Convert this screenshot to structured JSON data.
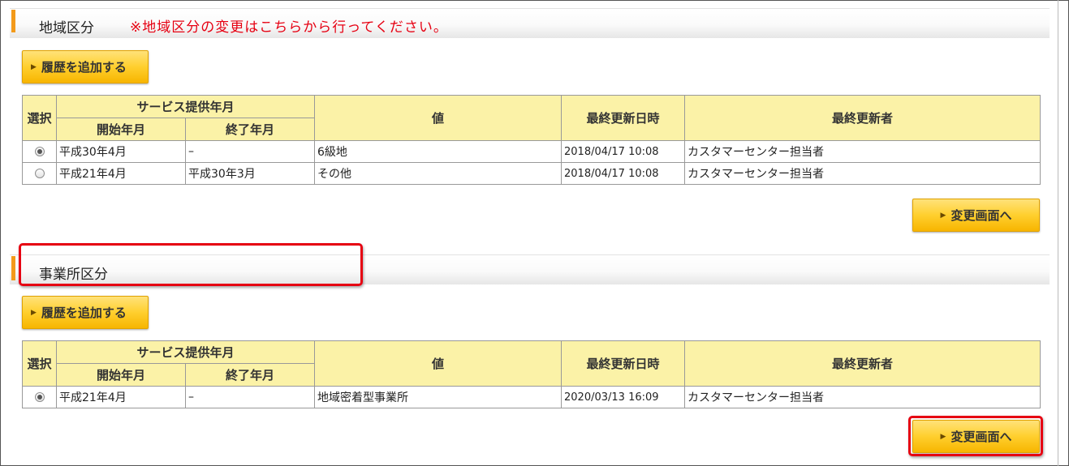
{
  "sections": [
    {
      "title": "地域区分",
      "notice": "※地域区分の変更はこちらから行ってください。",
      "add_button": "履歴を追加する",
      "change_button": "変更画面へ",
      "columns": {
        "select": "選択",
        "service_period": "サービス提供年月",
        "start": "開始年月",
        "end": "終了年月",
        "value": "値",
        "updated_at": "最終更新日時",
        "updated_by": "最終更新者"
      },
      "rows": [
        {
          "selected": true,
          "start": "平成30年4月",
          "end": "–",
          "value": "6級地",
          "updated_at": "2018/04/17 10:08",
          "updated_by": "カスタマーセンター担当者"
        },
        {
          "selected": false,
          "start": "平成21年4月",
          "end": "平成30年3月",
          "value": "その他",
          "updated_at": "2018/04/17 10:08",
          "updated_by": "カスタマーセンター担当者"
        }
      ]
    },
    {
      "title": "事業所区分",
      "add_button": "履歴を追加する",
      "change_button": "変更画面へ",
      "columns": {
        "select": "選択",
        "service_period": "サービス提供年月",
        "start": "開始年月",
        "end": "終了年月",
        "value": "値",
        "updated_at": "最終更新日時",
        "updated_by": "最終更新者"
      },
      "rows": [
        {
          "selected": true,
          "start": "平成21年4月",
          "end": "–",
          "value": "地域密着型事業所",
          "updated_at": "2020/03/13 16:09",
          "updated_by": "カスタマーセンター担当者"
        }
      ]
    }
  ],
  "colors": {
    "accent_bar": "#f39a1a",
    "button": "#ffcf2e",
    "table_header": "#fbf2a7",
    "highlight": "#e60012"
  }
}
